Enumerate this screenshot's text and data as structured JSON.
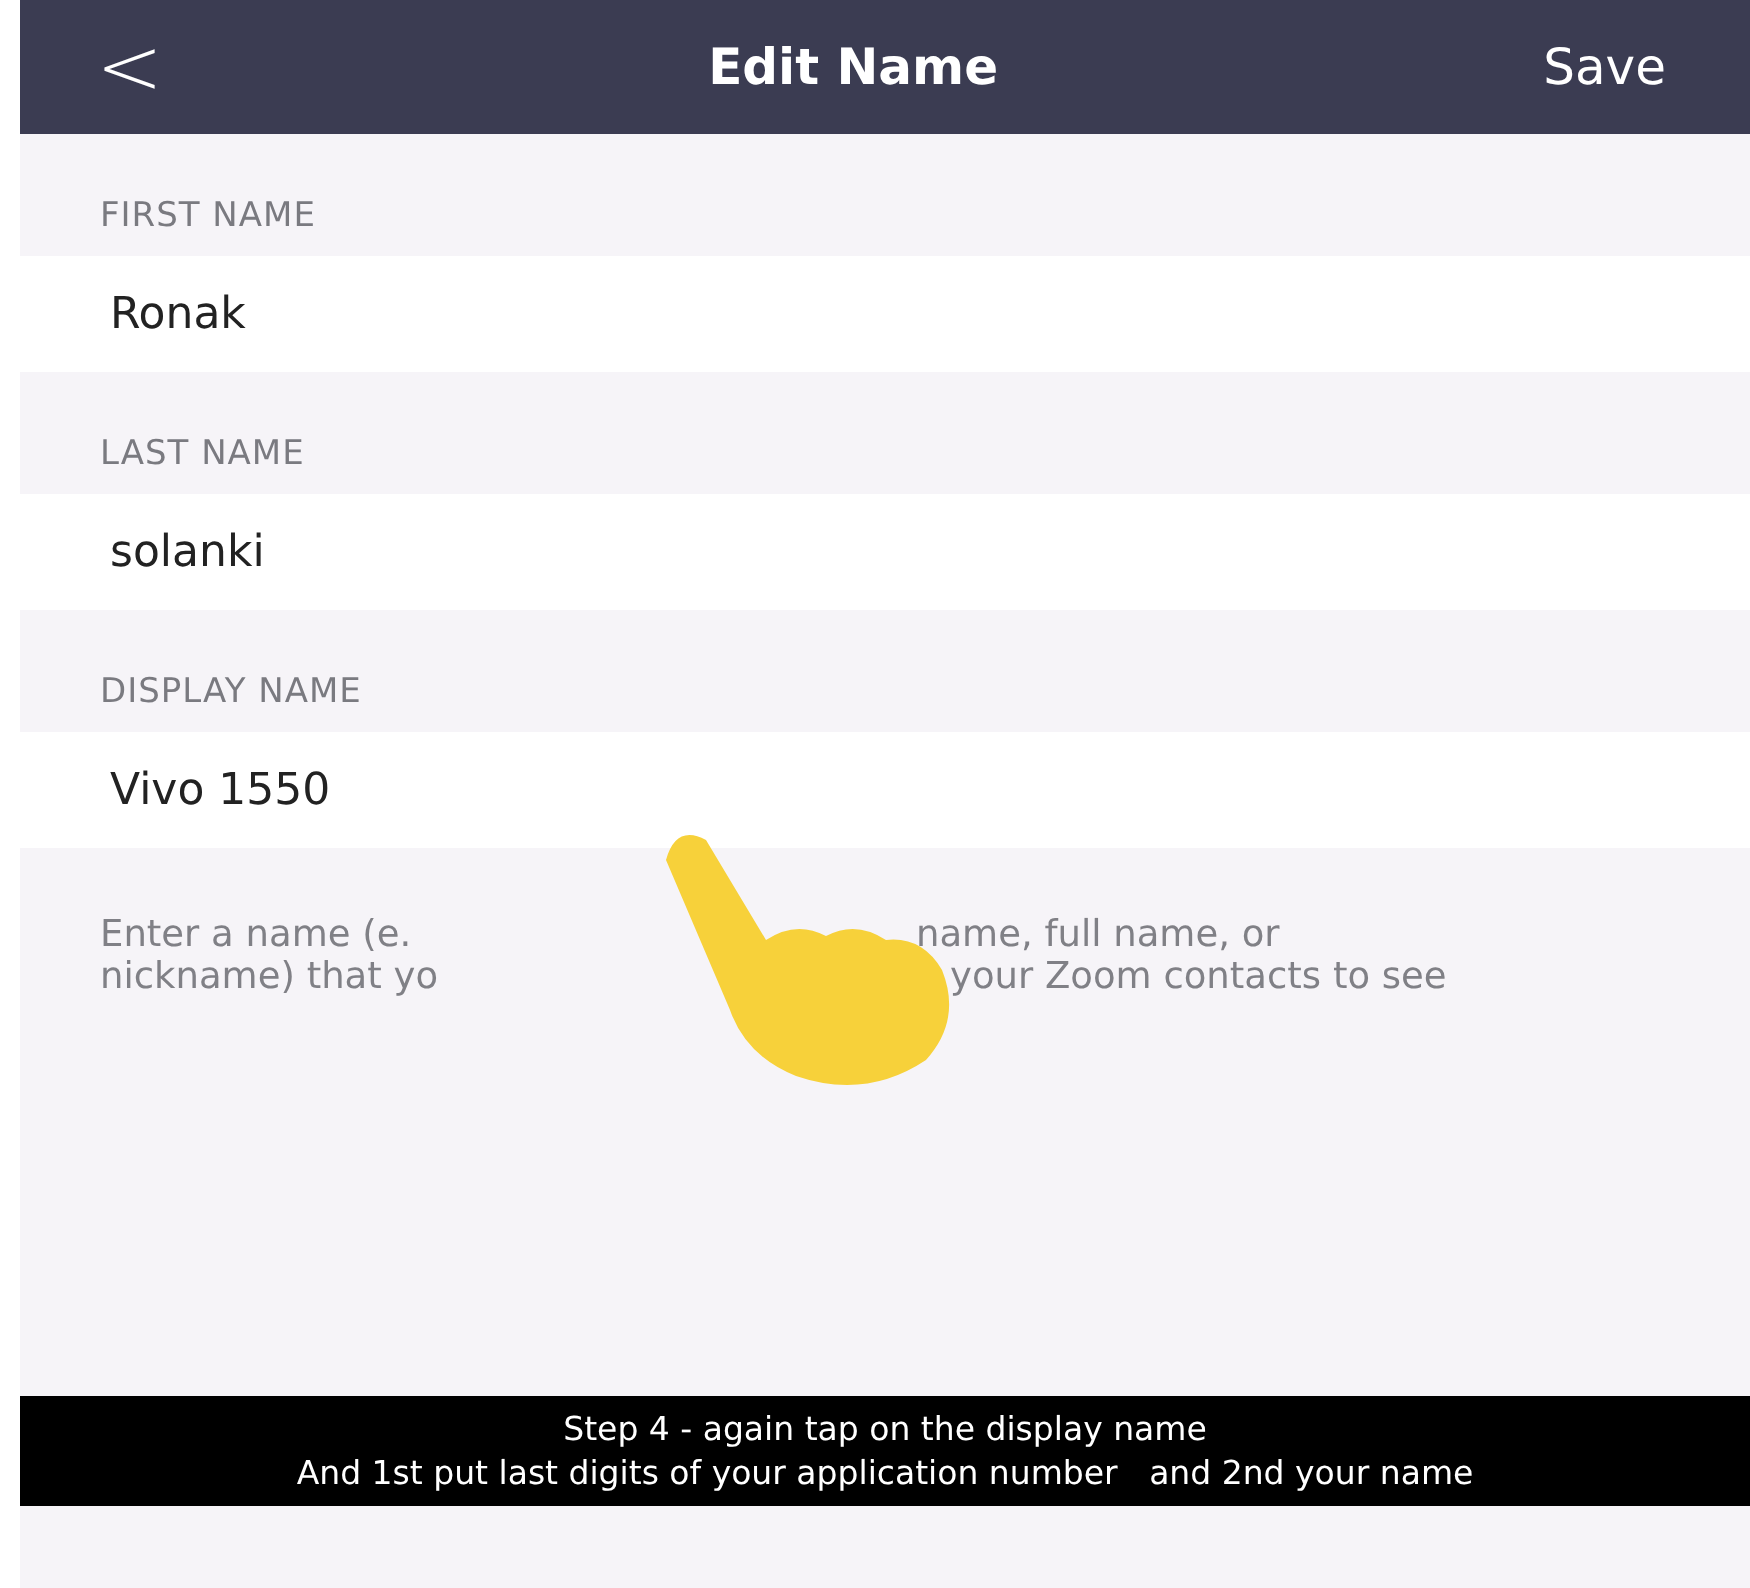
{
  "header": {
    "back": "<",
    "title": "Edit Name",
    "action": "Save"
  },
  "fields": [
    {
      "label": "FIRST NAME",
      "value": "Ronak"
    },
    {
      "label": "LAST NAME",
      "value": "solanki"
    },
    {
      "label": "DISPLAY NAME",
      "value": "Vivo 1550"
    }
  ],
  "hint": {
    "lines": [
      [
        "Enter a name (e.",
        "name, full name, or"
      ],
      [
        "nickname) that yo",
        "your Zoom contacts to see"
      ]
    ]
  },
  "caption": [
    "Step 4 - again tap on the display name",
    "And 1st put last digits of your application number   and 2nd your name"
  ]
}
